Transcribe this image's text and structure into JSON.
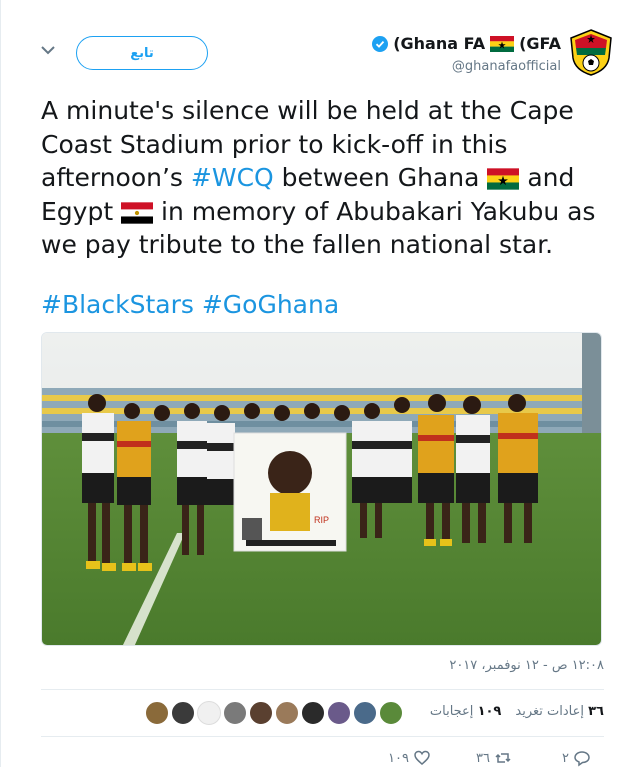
{
  "header": {
    "follow_label": "تابع",
    "display_name_part1": "(Ghana FA",
    "display_name_part2": "(GFA",
    "handle": "@ghanafaofficial"
  },
  "tweet": {
    "line1": "A minute's silence will be held at the Cape",
    "line2": "Coast Stadium prior to kick-off in this",
    "line3_a": "afternoon’s ",
    "line3_tag": "#WCQ",
    "line3_b": " between Ghana ",
    "line3_c": " and",
    "line4_a": "Egypt ",
    "line4_b": " in memory of Abubakari Yakubu as",
    "line5": "we pay tribute to the fallen national star.",
    "tag1": "#BlackStars",
    "tag2": "#GoGhana"
  },
  "meta": {
    "timestamp": "١٢:٠٨ ص - ١٢ نوفمبر، ٢٠١٧",
    "retweet_count": "٣٦",
    "retweet_label": "إعادات تغريد",
    "like_count": "١٠٩",
    "like_label": "إعجابات"
  },
  "actions": {
    "reply_count": "٢",
    "retweet_count": "٣٦",
    "like_count": "١٠٩"
  },
  "colors": {
    "accent": "#1da1f2",
    "link": "#1b95e0",
    "muted": "#657786"
  }
}
